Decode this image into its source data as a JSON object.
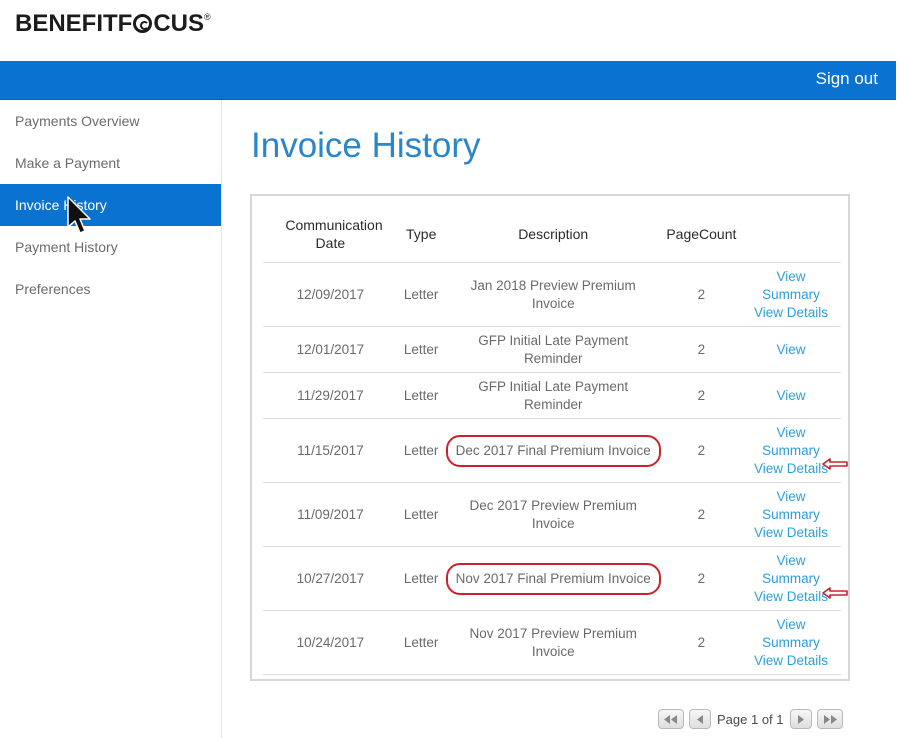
{
  "brand": {
    "logo_pre": "BENEFITF",
    "logo_post": "CUS",
    "logo_mark": "®"
  },
  "header": {
    "sign_out": "Sign out"
  },
  "sidebar": {
    "items": [
      {
        "label": "Payments Overview"
      },
      {
        "label": "Make a Payment"
      },
      {
        "label": "Invoice History",
        "active": true
      },
      {
        "label": "Payment History"
      },
      {
        "label": "Preferences"
      }
    ]
  },
  "page": {
    "title": "Invoice History"
  },
  "table": {
    "columns": [
      "Communication Date",
      "Type",
      "Description",
      "PageCount"
    ],
    "rows": [
      {
        "date": "12/09/2017",
        "type": "Letter",
        "description": "Jan 2018 Preview Premium Invoice",
        "page_count": "2",
        "links": [
          "View",
          "Summary",
          "View Details"
        ],
        "highlighted": false
      },
      {
        "date": "12/01/2017",
        "type": "Letter",
        "description": "GFP Initial Late Payment Reminder",
        "page_count": "2",
        "links": [
          "View"
        ],
        "highlighted": false
      },
      {
        "date": "11/29/2017",
        "type": "Letter",
        "description": "GFP Initial Late Payment Reminder",
        "page_count": "2",
        "links": [
          "View"
        ],
        "highlighted": false
      },
      {
        "date": "11/15/2017",
        "type": "Letter",
        "description": "Dec 2017 Final Premium Invoice",
        "page_count": "2",
        "links": [
          "View",
          "Summary",
          "View Details"
        ],
        "highlighted": true
      },
      {
        "date": "11/09/2017",
        "type": "Letter",
        "description": "Dec 2017 Preview Premium Invoice",
        "page_count": "2",
        "links": [
          "View",
          "Summary",
          "View Details"
        ],
        "highlighted": false
      },
      {
        "date": "10/27/2017",
        "type": "Letter",
        "description": "Nov 2017 Final Premium Invoice",
        "page_count": "2",
        "links": [
          "View",
          "Summary",
          "View Details"
        ],
        "highlighted": true
      },
      {
        "date": "10/24/2017",
        "type": "Letter",
        "description": "Nov 2017 Preview Premium Invoice",
        "page_count": "2",
        "links": [
          "View",
          "Summary",
          "View Details"
        ],
        "highlighted": false
      }
    ]
  },
  "pager": {
    "text": "Page 1 of 1"
  },
  "colors": {
    "brand_blue": "#0a73d1",
    "title_blue": "#2a86cb",
    "link_blue": "#2b9fdc",
    "annotation_red": "#c8232c"
  },
  "icons": [
    "first-page-icon",
    "prev-page-icon",
    "next-page-icon",
    "last-page-icon",
    "annotation-arrow-icon",
    "mouse-cursor-icon"
  ]
}
